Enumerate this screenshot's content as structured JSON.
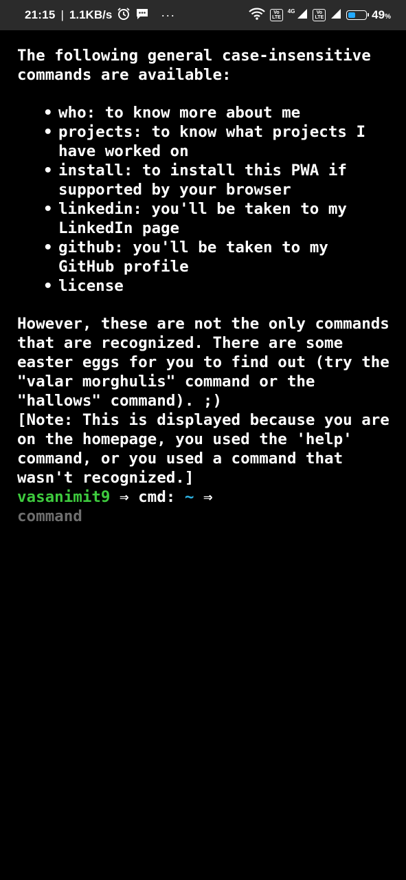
{
  "status_bar": {
    "time": "21:15",
    "separator": "|",
    "net_speed": "1.1KB/s",
    "overflow_dots": "···",
    "volte_label_1": "Vo\nLTE",
    "network_type": "4G",
    "volte_label_2": "Vo\nLTE",
    "battery_percent": "49",
    "battery_percent_sign": "%",
    "battery_level_fraction": 0.49,
    "battery_color": "#21a9ff"
  },
  "terminal": {
    "intro": "The following general case-insensitive commands are available:",
    "commands": [
      "who: to know more about me",
      "projects: to know what projects I have worked on",
      "install: to install this PWA if supported by your browser",
      "linkedin: you'll be taken to my LinkedIn page",
      "github: you'll be taken to my GitHub profile",
      "license"
    ],
    "outro": "However, these are not the only commands that are recognized. There are some easter eggs for you to find out (try the \"valar morghulis\" command or the \"hallows\" command). ;)",
    "note": "[Note: This is displayed because you are on the homepage, you used the 'help' command, or you used a command that wasn't recognized.]",
    "prompt": {
      "user": "vasanimit9",
      "arrow1": "⇒",
      "cmd_label": "cmd:",
      "tilde": "~",
      "arrow2": "⇒"
    },
    "input_placeholder": "command",
    "input_value": ""
  },
  "colors": {
    "background": "#000000",
    "text": "#ffffff",
    "prompt_user": "#3ecb3e",
    "prompt_tilde": "#2fb8ea",
    "placeholder": "#6e6e6e",
    "status_bar_bg": "#2b2b2b"
  }
}
